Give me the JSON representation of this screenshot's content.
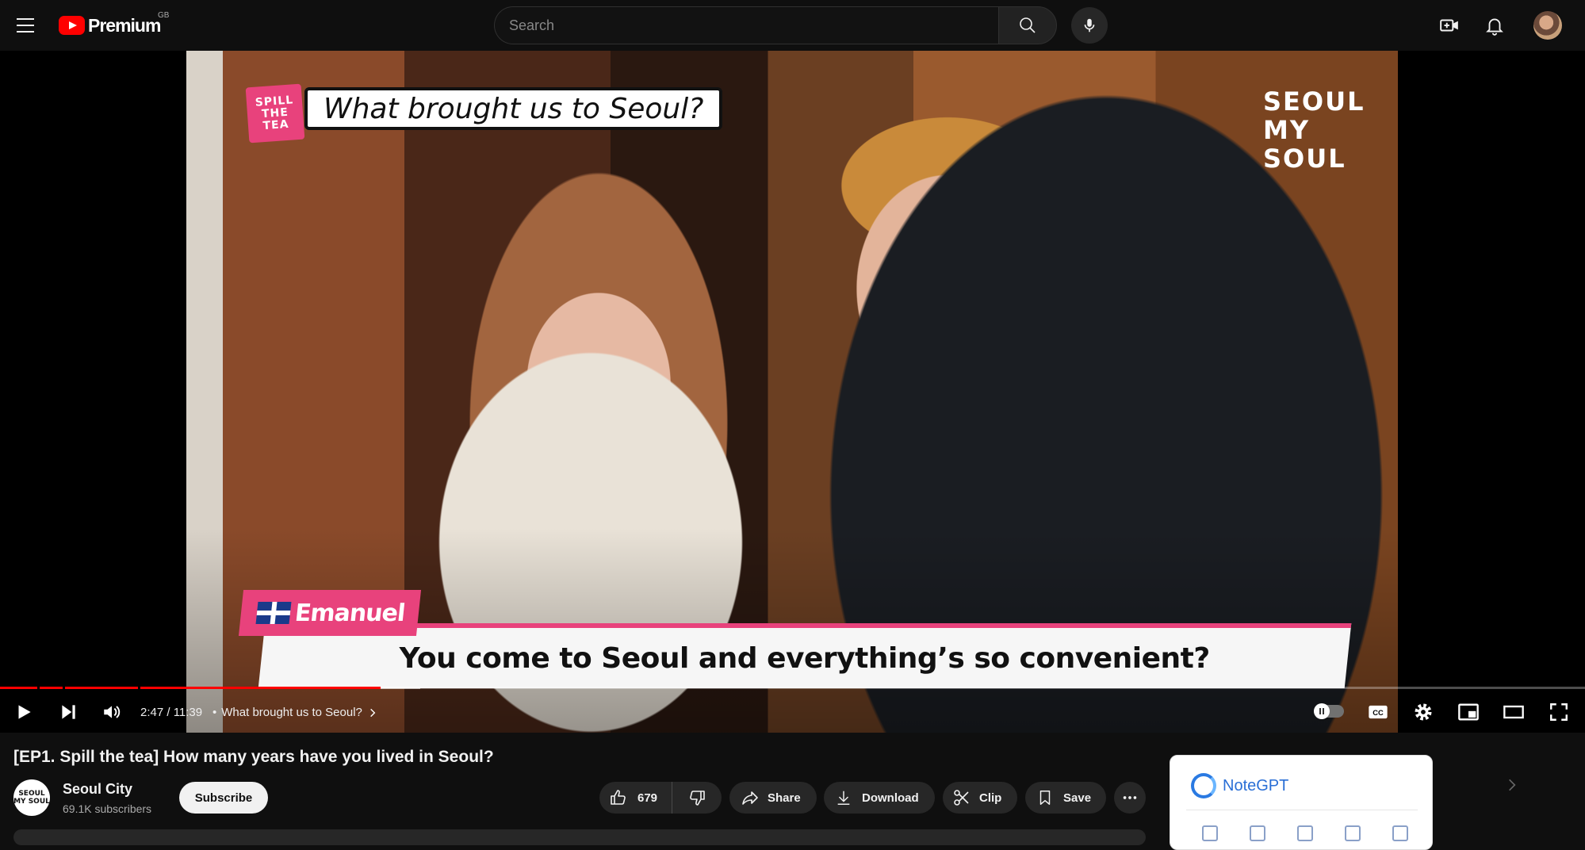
{
  "masthead": {
    "logo_text": "Premium",
    "region": "GB",
    "search_placeholder": "Search"
  },
  "video": {
    "overlay_question": "What brought us to Seoul?",
    "spill_logo_lines": [
      "SPILL",
      "THE",
      "TEA"
    ],
    "brand_logo_lines": [
      "SEOUL",
      "MY SOUL"
    ],
    "speaker_name": "Emanuel",
    "subtitle": "You come to Seoul and everything’s so convenient?"
  },
  "player": {
    "time_display": "2:47 / 11:39",
    "chapter_separator": "•",
    "chapter_title": "What brought us to Seoul?",
    "progress_played": 0.24,
    "progress_loaded": 0.265,
    "chapter_marks": [
      0.0235,
      0.0395,
      0.087
    ]
  },
  "watch": {
    "title": "[EP1. Spill the tea] How many years have you lived in Seoul?",
    "channel_name": "Seoul City",
    "channel_avatar_text": "SEOUL MY SOUL",
    "subscribers": "69.1K subscribers",
    "subscribe_label": "Subscribe",
    "like_count": "679",
    "share_label": "Share",
    "download_label": "Download",
    "clip_label": "Clip",
    "save_label": "Save"
  },
  "notegpt": {
    "name": "NoteGPT"
  },
  "colors": {
    "accent": "#ff0000",
    "background": "#0f0f0f",
    "pill": "#272727",
    "notegpt_blue": "#2a6fd6",
    "overlay_pink": "#e8427c"
  }
}
